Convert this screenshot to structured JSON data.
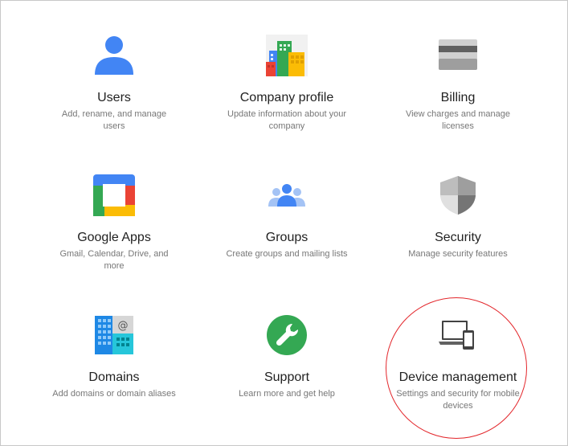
{
  "tiles": [
    {
      "title": "Users",
      "desc": "Add, rename, and manage users",
      "icon": "users-icon"
    },
    {
      "title": "Company profile",
      "desc": "Update information about your company",
      "icon": "company-profile-icon"
    },
    {
      "title": "Billing",
      "desc": "View charges and manage licenses",
      "icon": "billing-card-icon"
    },
    {
      "title": "Google Apps",
      "desc": "Gmail, Calendar, Drive, and more",
      "icon": "google-apps-icon"
    },
    {
      "title": "Groups",
      "desc": "Create groups and mailing lists",
      "icon": "groups-icon"
    },
    {
      "title": "Security",
      "desc": "Manage security features",
      "icon": "security-shield-icon"
    },
    {
      "title": "Domains",
      "desc": "Add domains or domain aliases",
      "icon": "domains-icon"
    },
    {
      "title": "Support",
      "desc": "Learn more and get help",
      "icon": "support-wrench-icon"
    },
    {
      "title": "Device management",
      "desc": "Settings and security for mobile devices",
      "icon": "device-management-icon"
    }
  ],
  "colors": {
    "google_blue": "#4285f4",
    "google_red": "#ea4335",
    "google_yellow": "#fbbc05",
    "google_green": "#34a853",
    "highlight": "#e3262b",
    "title_text": "#222222",
    "desc_text": "#777777"
  }
}
